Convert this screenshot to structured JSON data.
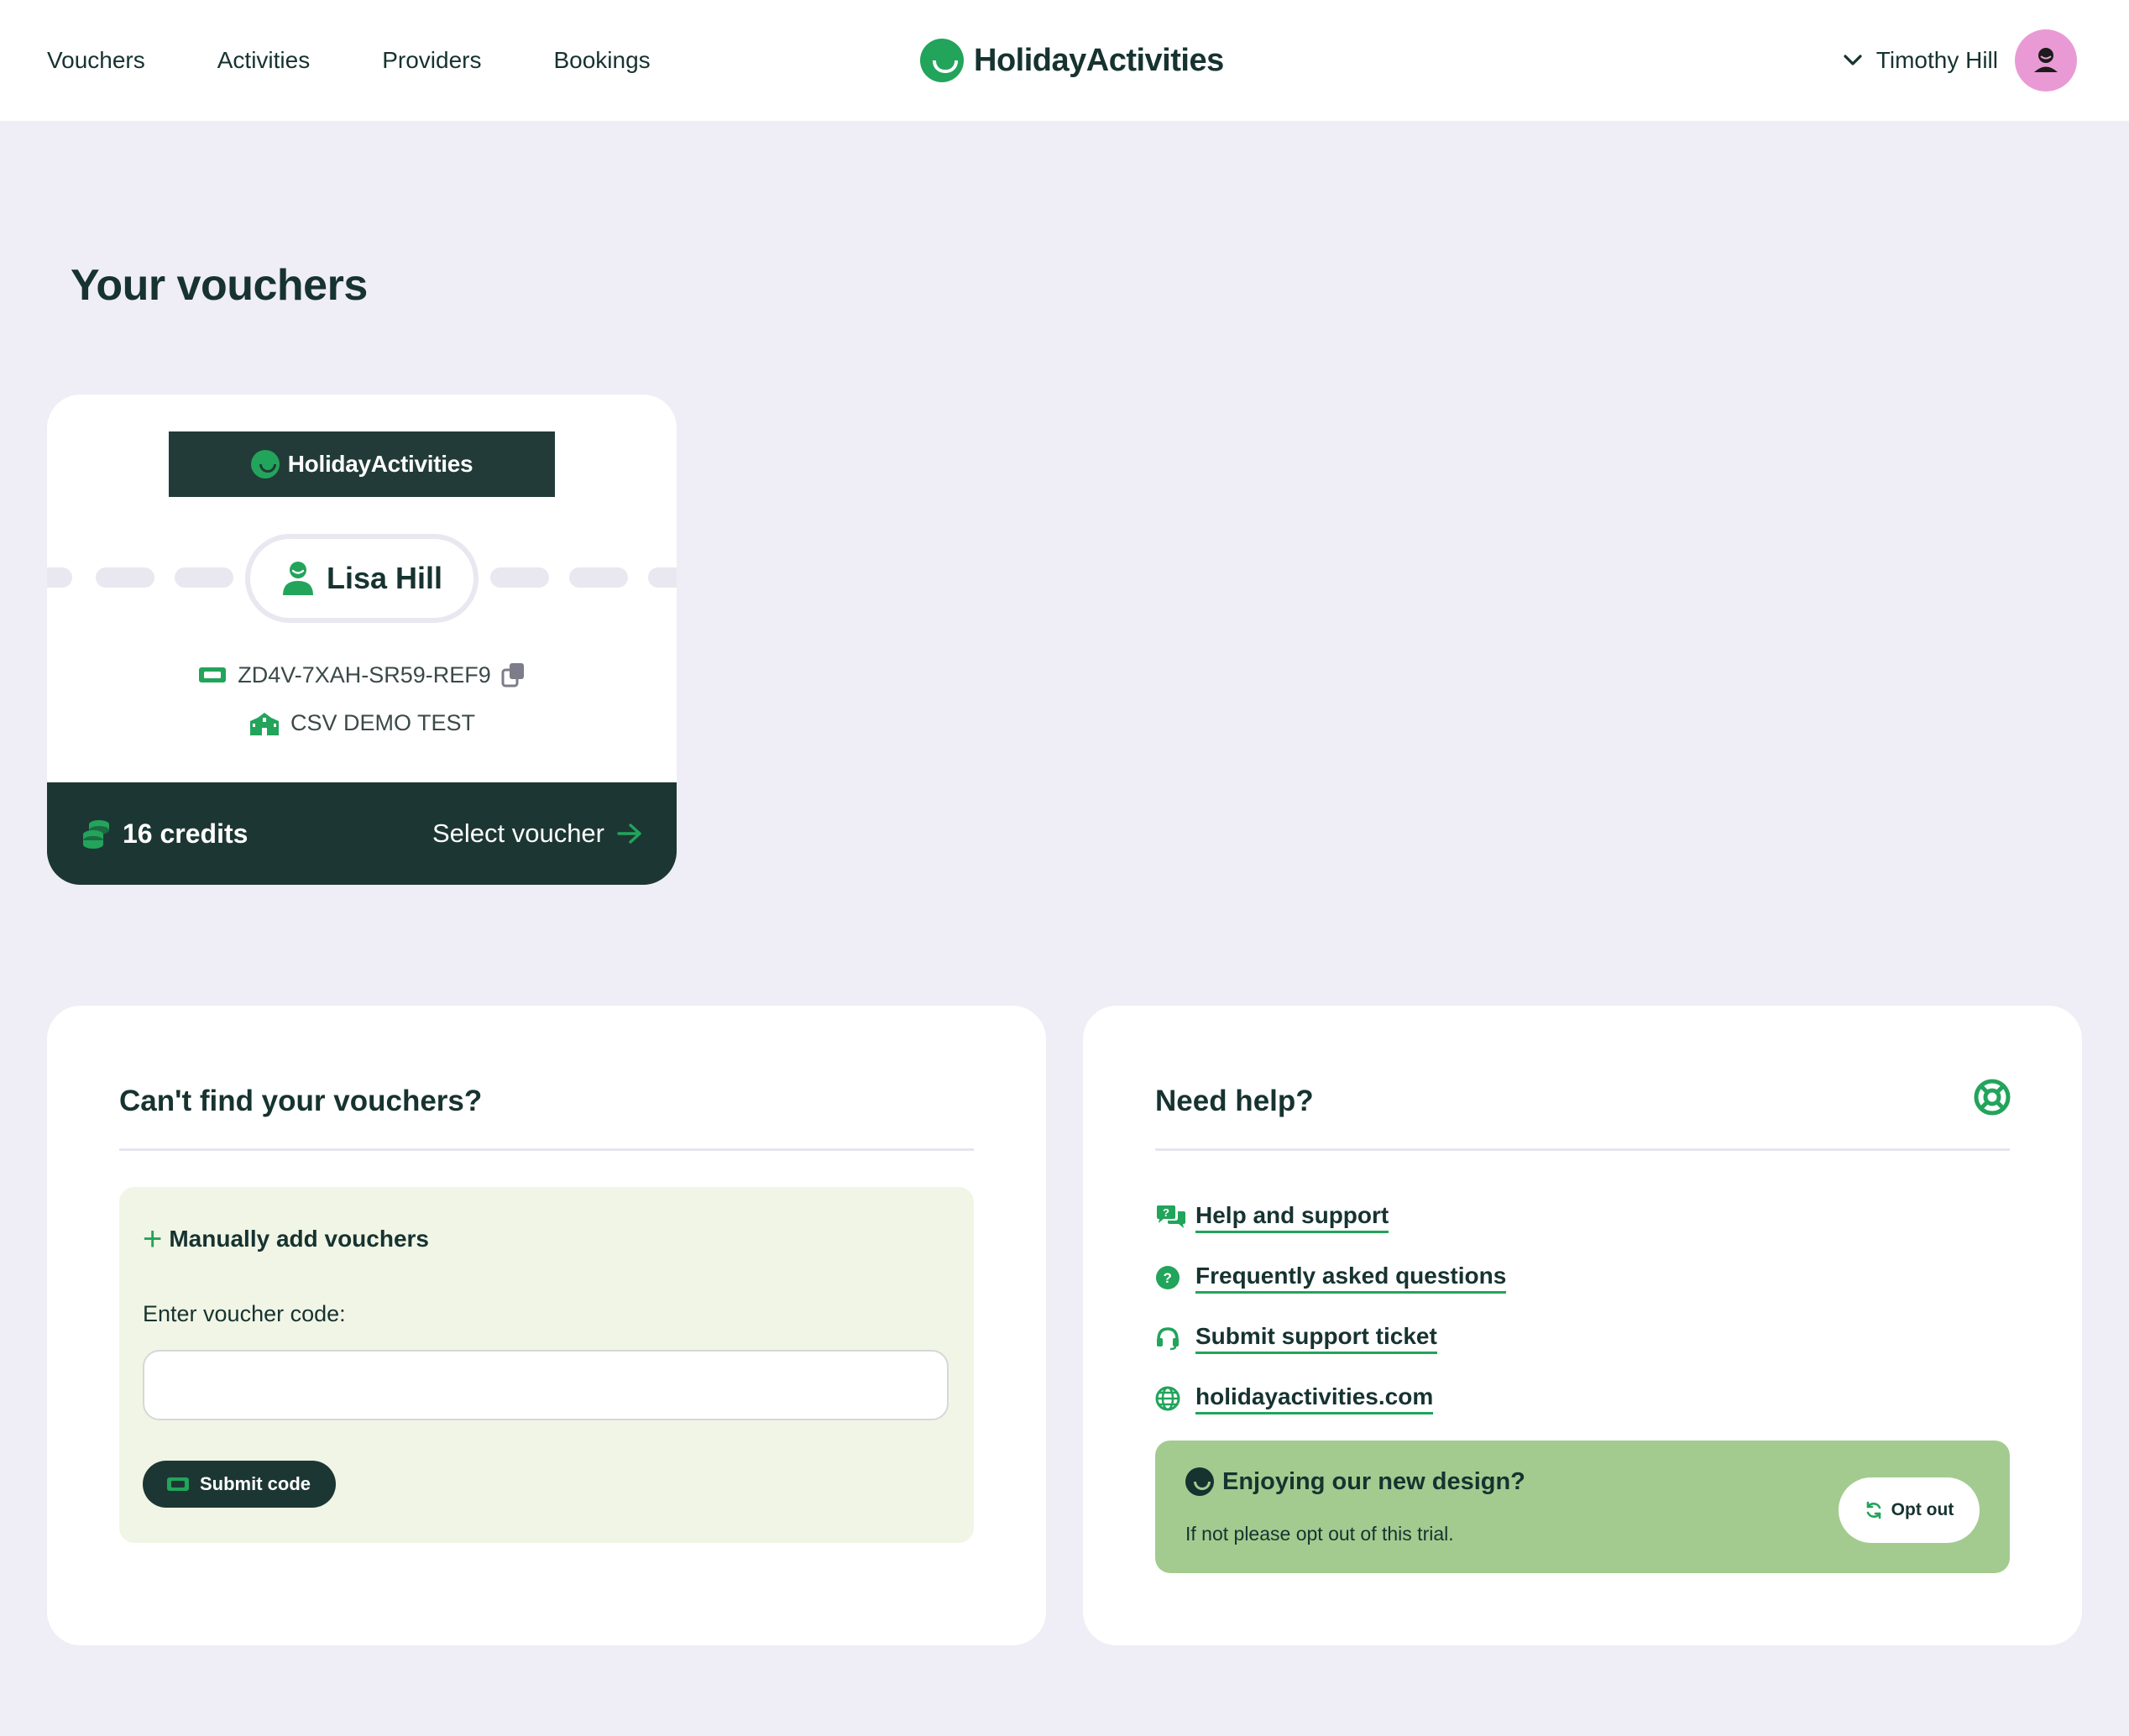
{
  "header": {
    "nav": [
      "Vouchers",
      "Activities",
      "Providers",
      "Bookings"
    ],
    "brand": "HolidayActivities",
    "user_name": "Timothy Hill"
  },
  "page": {
    "title": "Your vouchers"
  },
  "voucher": {
    "banner": "HolidayActivities",
    "holder": "Lisa Hill",
    "code": "ZD4V-7XAH-SR59-REF9",
    "organization": "CSV DEMO TEST",
    "credits": "16 credits",
    "select_label": "Select voucher"
  },
  "missing": {
    "title": "Can't find your vouchers?",
    "add_heading": "Manually add vouchers",
    "field_label": "Enter voucher code:",
    "input_value": "",
    "submit_label": "Submit code"
  },
  "help": {
    "title": "Need help?",
    "links": [
      {
        "label": "Help and support",
        "icon": "chat-question-icon"
      },
      {
        "label": "Frequently asked questions",
        "icon": "question-circle-icon"
      },
      {
        "label": "Submit support ticket",
        "icon": "headset-icon"
      },
      {
        "label": "holidayactivities.com",
        "icon": "globe-icon"
      }
    ],
    "trial_title": "Enjoying our new design?",
    "trial_text": "If not please opt out of this trial.",
    "optout_label": "Opt out"
  },
  "colors": {
    "brand_green": "#22a45b",
    "dark": "#1c3733",
    "background": "#efedf5",
    "avatar": "#e99ad4",
    "trial": "#a3cb8f"
  }
}
